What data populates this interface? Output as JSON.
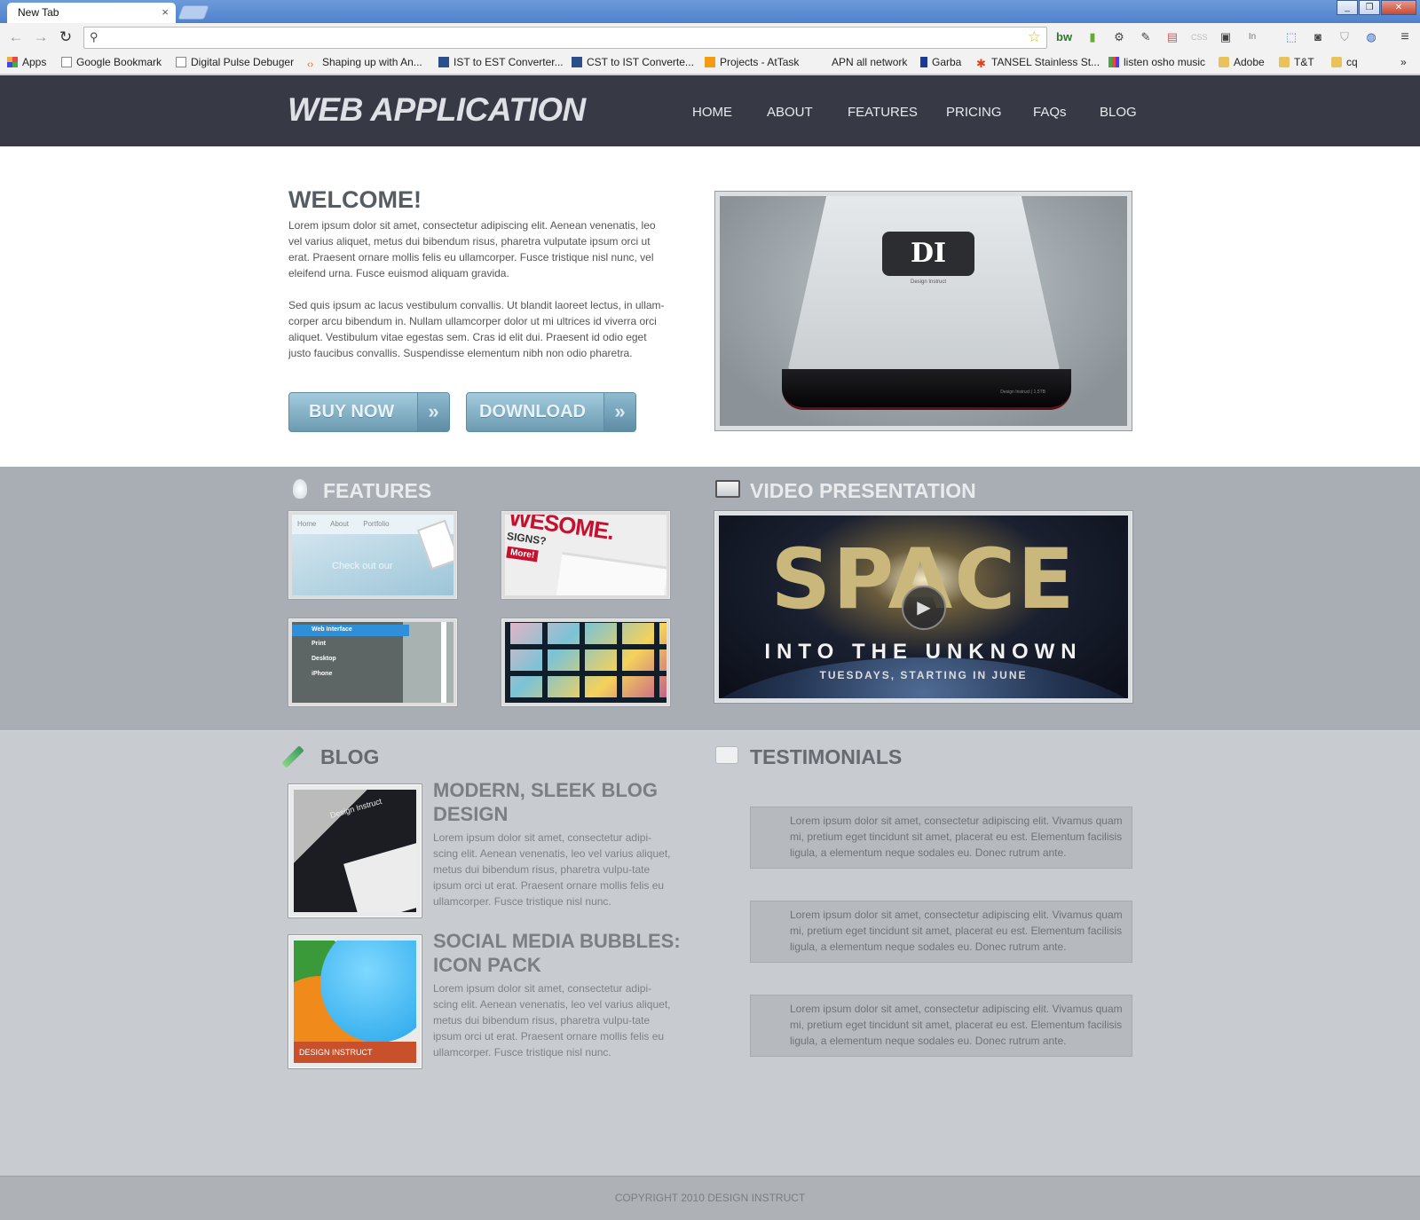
{
  "browser": {
    "tab_title": "New Tab",
    "tab_close": "×",
    "address_value": "",
    "bookmarks": [
      "Apps",
      "Google Bookmark",
      "Digital Pulse Debuger",
      "Shaping up with An...",
      "IST to EST Converter...",
      "CST to IST Converte...",
      "Projects - AtTask",
      "APN all network",
      "Garba",
      "TANSEL Stainless St...",
      "listen osho music",
      "Adobe",
      "T&T",
      "cq"
    ],
    "overflow": "»"
  },
  "site": {
    "logo": "WEB APPLICATION",
    "nav": [
      "HOME",
      "ABOUT",
      "FEATURES",
      "PRICING",
      "FAQs",
      "BLOG"
    ]
  },
  "hero": {
    "title": "WELCOME!",
    "paragraph1": "Lorem ipsum dolor sit amet, consectetur adipiscing elit. Aenean venenatis, leo vel varius aliquet, metus dui bibendum risus, pharetra vulputate ipsum orci ut erat. Praesent ornare mollis felis eu ullamcorper. Fusce tristique nisl nunc, vel eleifend urna. Fusce euismod aliquam gravida.",
    "paragraph2": "Sed quis ipsum ac lacus vestibulum convallis. Ut blandit laoreet lectus, in ullam-corper arcu bibendum in. Nullam ullamcorper dolor ut mi ultrices id viverra orci aliquet. Vestibulum vitae egestas sem. Cras id elit dui. Praesent id odio eget justo faucibus convallis. Suspendisse elementum nibh non odio pharetra.",
    "buy_label": "BUY NOW",
    "download_label": "DOWNLOAD",
    "arrow": "»",
    "drive_logo": "DI",
    "drive_sub": "Design Instruct",
    "drive_foot": "Design Instruct  |  1.5TB"
  },
  "features": {
    "title": "FEATURES",
    "thumb1_nav": [
      "Home",
      "About",
      "Portfolio"
    ],
    "thumb1_text": "Check out our",
    "thumb2_text": "WESOME.",
    "thumb2_sub": "SIGNS?",
    "thumb2_more": "More!",
    "thumb3_items": [
      "Web Interface",
      "Print",
      "Desktop",
      "iPhone"
    ]
  },
  "video": {
    "title": "VIDEO PRESENTATION",
    "headline": "SPACE",
    "subline": "INTO THE UNKNOWN",
    "tagline": "TUESDAYS, STARTING IN JUNE"
  },
  "blog": {
    "title": "BLOG",
    "posts": [
      {
        "title": "MODERN, SLEEK BLOG DESIGN",
        "text": "Lorem ipsum dolor sit amet, consectetur adipi-scing elit. Aenean venenatis, leo vel varius aliquet, metus dui bibendum risus, pharetra vulpu-tate ipsum orci ut erat. Praesent ornare mollis felis eu ullamcorper. Fusce tristique nisl nunc.",
        "image_text": "Design Instruct"
      },
      {
        "title": "SOCIAL MEDIA BUBBLES: ICON PACK",
        "text": "Lorem ipsum dolor sit amet, consectetur adipi-scing elit. Aenean venenatis, leo vel varius aliquet, metus dui bibendum risus, pharetra vulpu-tate ipsum orci ut erat. Praesent ornare mollis felis eu ullamcorper. Fusce tristique nisl nunc.",
        "image_text": "DESIGN INSTRUCT"
      }
    ]
  },
  "testimonials": {
    "title": "TESTIMONIALS",
    "items": [
      "Lorem ipsum dolor sit amet, consectetur adipiscing elit. Vivamus quam mi, pretium eget tincidunt sit amet, placerat eu est. Elementum facilisis ligula, a elementum neque sodales eu. Donec rutrum ante.",
      "Lorem ipsum dolor sit amet, consectetur adipiscing elit. Vivamus quam mi, pretium eget tincidunt sit amet, placerat eu est. Elementum facilisis ligula, a elementum neque sodales eu. Donec rutrum ante.",
      "Lorem ipsum dolor sit amet, consectetur adipiscing elit. Vivamus quam mi, pretium eget tincidunt sit amet, placerat eu est. Elementum facilisis ligula, a elementum neque sodales eu. Donec rutrum ante."
    ]
  },
  "footer": {
    "copyright": "COPYRIGHT 2010 DESIGN INSTRUCT"
  },
  "colors": {
    "header_bg": "#373a45",
    "band_bg": "#a9aeb4",
    "button_accent": "#7fb0c6"
  }
}
